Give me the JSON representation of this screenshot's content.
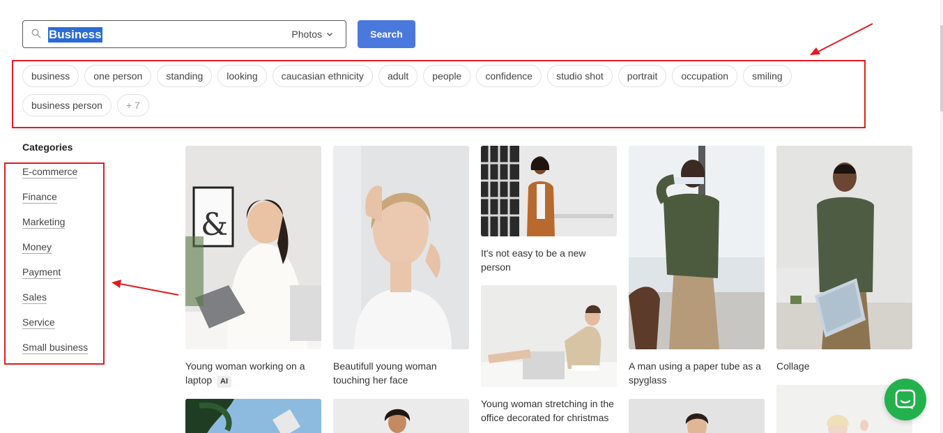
{
  "search": {
    "query": "Business",
    "type_label": "Photos",
    "button_label": "Search"
  },
  "tags": [
    "business",
    "one person",
    "standing",
    "looking",
    "caucasian ethnicity",
    "adult",
    "people",
    "confidence",
    "studio shot",
    "portrait",
    "occupation",
    "smiling",
    "business person"
  ],
  "more_tags_label": "+ 7",
  "categories": {
    "title": "Categories",
    "items": [
      "E-commerce",
      "Finance",
      "Marketing",
      "Money",
      "Payment",
      "Sales",
      "Service",
      "Small business"
    ]
  },
  "photos": [
    {
      "caption": "Young woman working on a laptop",
      "badge": "AI"
    },
    {
      "caption": "Beautifull young woman touching her face"
    },
    {
      "caption": "It's not easy to be a new person"
    },
    {
      "caption": "Young woman stretching in the office decorated for christmas"
    },
    {
      "caption": "A man using a paper tube as a spyglass"
    },
    {
      "caption": "Collage"
    }
  ],
  "colors": {
    "primary_button": "#4a78dc",
    "annotation_red": "#e11b22",
    "chat_green": "#22b14c",
    "selection_blue": "#2b6bd4"
  },
  "icons": [
    "search-icon",
    "chevron-down-icon",
    "chat-icon"
  ]
}
